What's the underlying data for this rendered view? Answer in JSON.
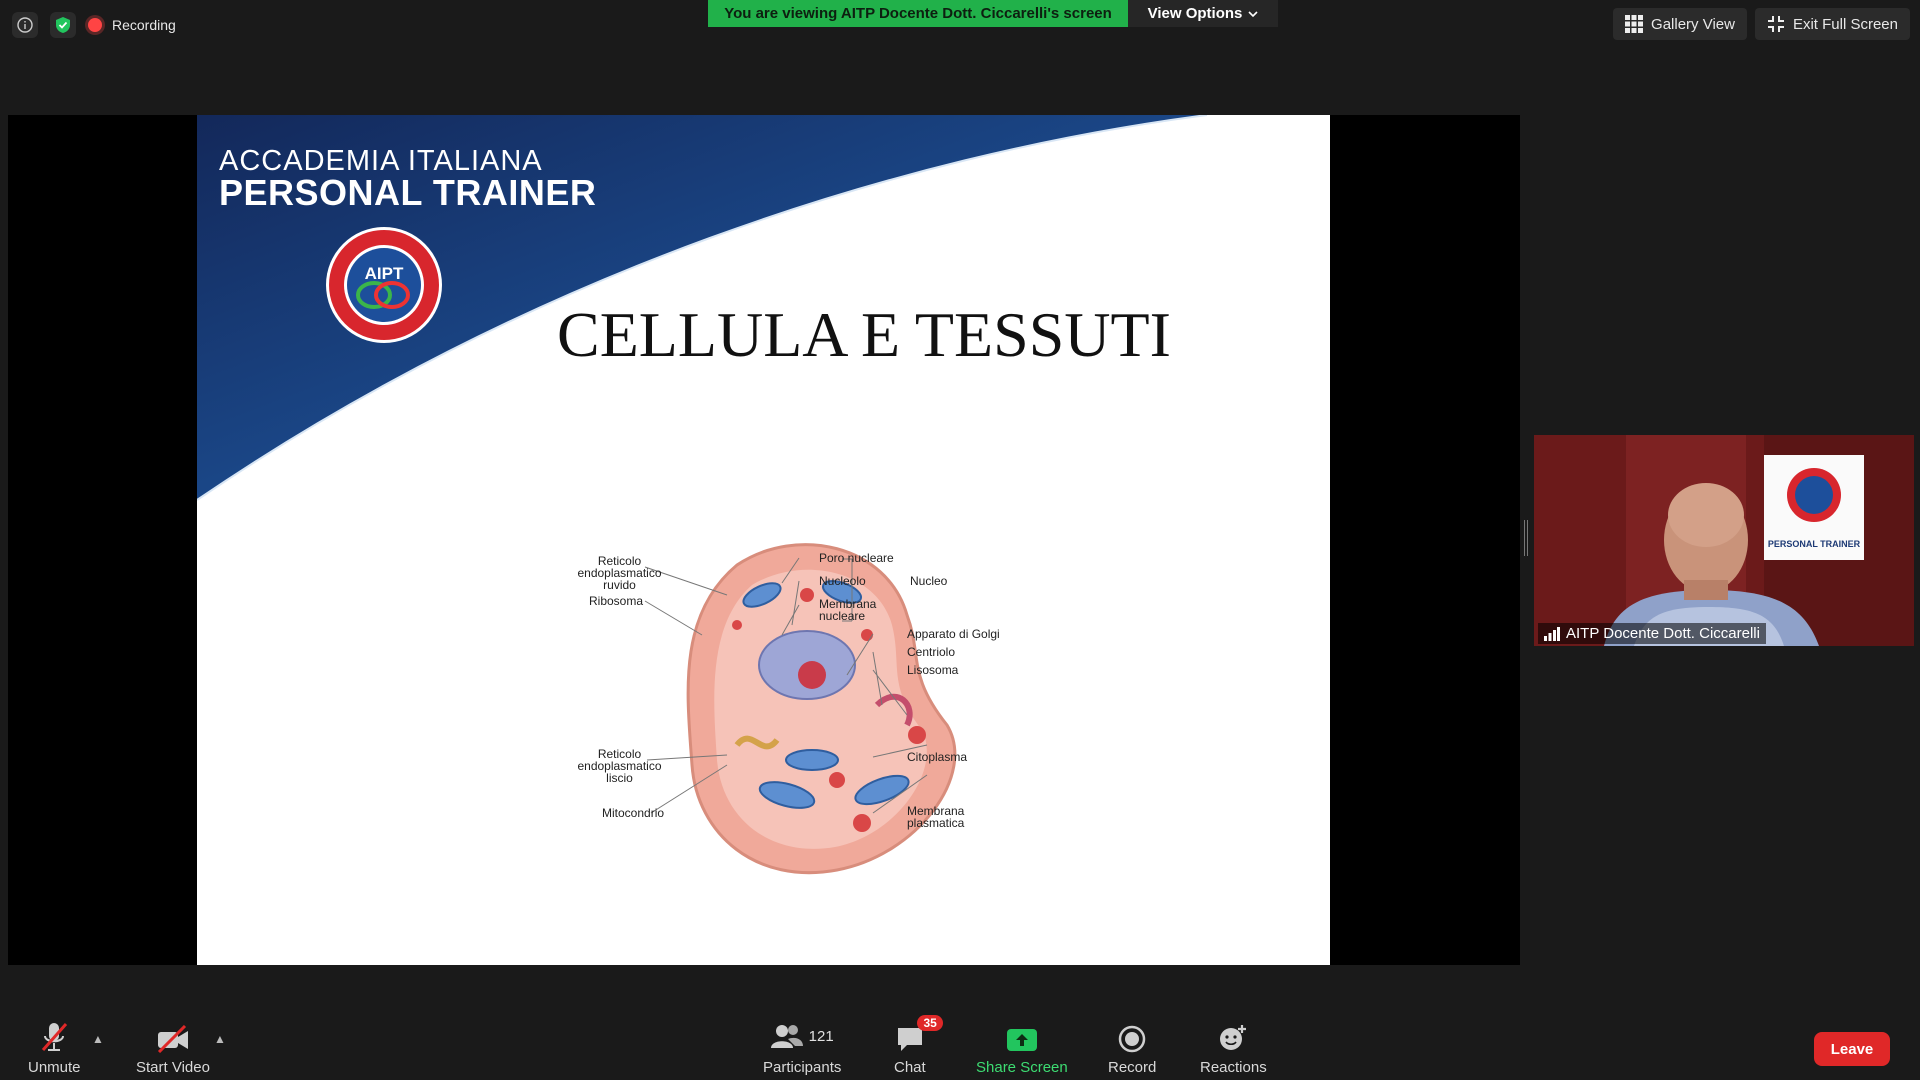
{
  "meeting": {
    "recording_label": "Recording",
    "share_banner": "You are viewing AITP Docente Dott. Ciccarelli's screen",
    "view_options": "View Options"
  },
  "top_right": {
    "gallery_view": "Gallery View",
    "exit_full_screen": "Exit Full Screen"
  },
  "slide": {
    "brand_line1": "ACCADEMIA ITALIANA",
    "brand_line2": "PERSONAL TRAINER",
    "logo_text": "AIPT",
    "title": "CELLULA E TESSUTI",
    "diagram_labels": {
      "reticolo_ruvido": "Reticolo endoplasmatico ruvido",
      "ribosoma": "Ribosoma",
      "poro_nucleare": "Poro nucleare",
      "nucleolo": "Nucleolo",
      "membrana_nucleare": "Membrana nucleare",
      "nucleo": "Nucleo",
      "golgi": "Apparato di Golgi",
      "centriolo": "Centriolo",
      "lisosoma": "Lisosoma",
      "citoplasma": "Citoplasma",
      "reticolo_liscio": "Reticolo endoplasmatico liscio",
      "mitocondrio": "Mitocondrio",
      "membrana_plasmatica": "Membrana plasmatica"
    }
  },
  "video_tile": {
    "participant_name": "AITP Docente Dott. Ciccarelli",
    "poster_line": "PERSONAL TRAINER"
  },
  "toolbar": {
    "unmute": "Unmute",
    "start_video": "Start Video",
    "participants": "Participants",
    "participants_count": "121",
    "chat": "Chat",
    "chat_badge": "35",
    "share_screen": "Share Screen",
    "record": "Record",
    "reactions": "Reactions",
    "leave": "Leave"
  },
  "colors": {
    "share_banner": "#21b14a",
    "leave": "#e02828",
    "slide_blue": "#1b3f7a"
  }
}
